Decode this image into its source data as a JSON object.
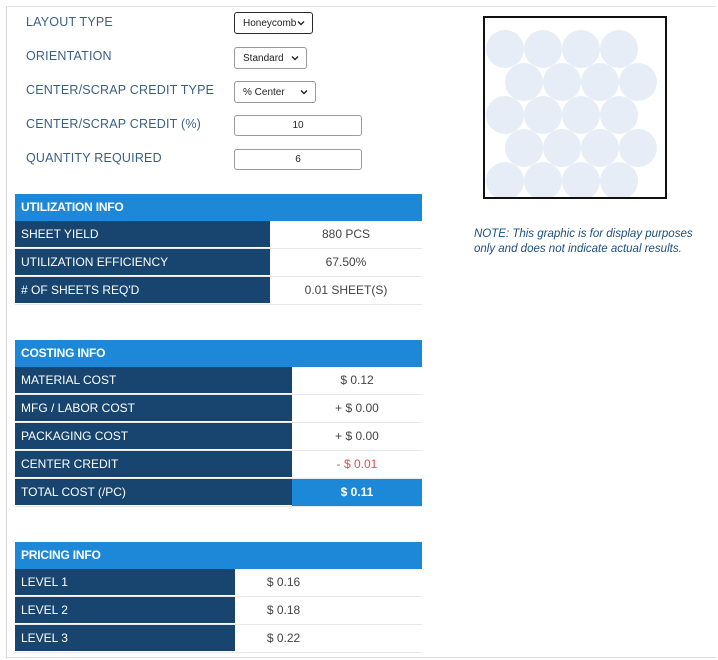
{
  "form": {
    "layout_type": {
      "label": "LAYOUT TYPE",
      "value": "Honeycomb"
    },
    "orientation": {
      "label": "ORIENTATION",
      "value": "Standard"
    },
    "credit_type": {
      "label": "CENTER/SCRAP CREDIT TYPE",
      "value": "% Center"
    },
    "credit_pct": {
      "label": "CENTER/SCRAP CREDIT (%)",
      "value": "10"
    },
    "quantity": {
      "label": "QUANTITY REQUIRED",
      "value": "6"
    }
  },
  "utilization": {
    "title": "UTILIZATION INFO",
    "rows": [
      {
        "label": "SHEET YIELD",
        "value": "880 PCS"
      },
      {
        "label": "UTILIZATION EFFICIENCY",
        "value": "67.50%"
      },
      {
        "label": "# OF SHEETS REQ'D",
        "value": "0.01 SHEET(S)"
      }
    ]
  },
  "costing": {
    "title": "COSTING INFO",
    "rows": [
      {
        "label": "MATERIAL COST",
        "value": "$ 0.12"
      },
      {
        "label": "MFG / LABOR COST",
        "value": "+ $ 0.00"
      },
      {
        "label": "PACKAGING COST",
        "value": "+ $ 0.00"
      },
      {
        "label": "CENTER CREDIT",
        "value": "- $ 0.01"
      },
      {
        "label": "TOTAL COST (/PC)",
        "value": "$ 0.11"
      }
    ]
  },
  "pricing": {
    "title": "PRICING INFO",
    "rows": [
      {
        "label": "LEVEL 1",
        "value": "$ 0.16"
      },
      {
        "label": "LEVEL 2",
        "value": "$ 0.18"
      },
      {
        "label": "LEVEL 3",
        "value": "$ 0.22"
      }
    ]
  },
  "note": "NOTE: This graphic is for display purposes only and does not indicate actual results.",
  "colors": {
    "header": "#1e88d8",
    "label_cell": "#17456f",
    "negative": "#e94b4b",
    "circle": "#e6edf7"
  }
}
